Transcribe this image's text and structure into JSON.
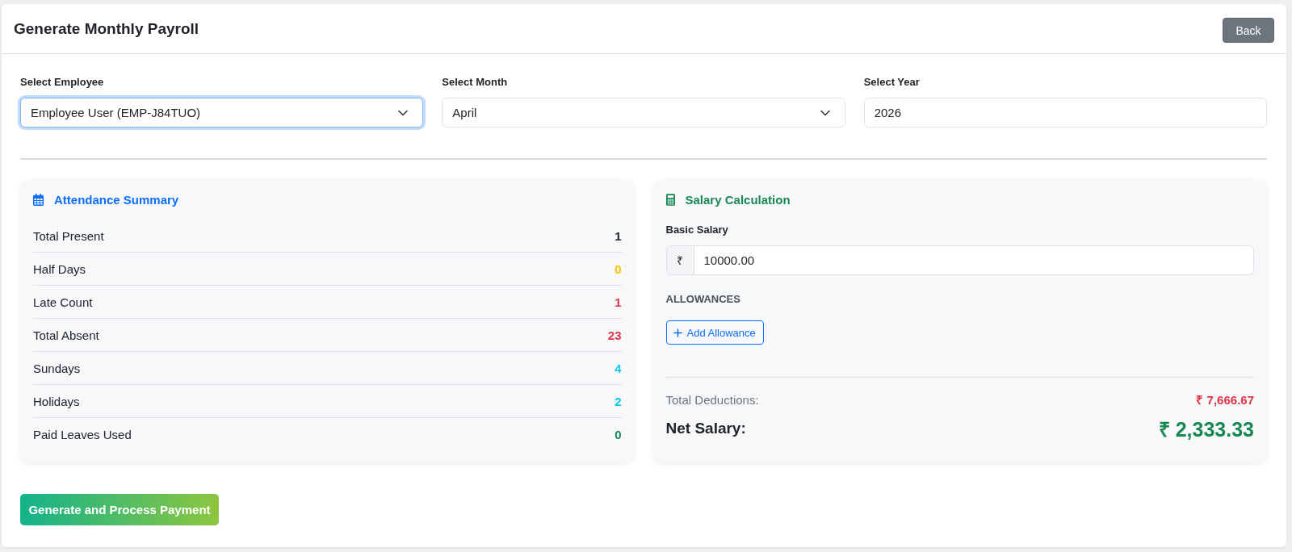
{
  "header": {
    "title": "Generate Monthly Payroll",
    "back_button": "Back"
  },
  "filters": [
    {
      "kind": "select",
      "label": "Select Employee",
      "value": "Employee User (EMP-J84TUO)",
      "focused": true
    },
    {
      "kind": "select",
      "label": "Select Month",
      "value": "April",
      "focused": false
    },
    {
      "kind": "input",
      "label": "Select Year",
      "value": "2026",
      "focused": false
    }
  ],
  "attendance": {
    "title": "Attendance Summary",
    "rows": [
      {
        "label": "Total Present",
        "value": "1",
        "color": "#212529"
      },
      {
        "label": "Half Days",
        "value": "0",
        "color": "#ffc107"
      },
      {
        "label": "Late Count",
        "value": "1",
        "color": "#dc3545"
      },
      {
        "label": "Total Absent",
        "value": "23",
        "color": "#dc3545"
      },
      {
        "label": "Sundays",
        "value": "4",
        "color": "#0dcaf0"
      },
      {
        "label": "Holidays",
        "value": "2",
        "color": "#0dcaf0"
      },
      {
        "label": "Paid Leaves Used",
        "value": "0",
        "color": "#198754"
      }
    ]
  },
  "salary": {
    "title": "Salary Calculation",
    "basic_salary": {
      "label": "Basic Salary",
      "currency": "₹",
      "value": "10000.00"
    },
    "allowances": {
      "heading": "ALLOWANCES",
      "add_button": "Add Allowance"
    },
    "total_deductions": {
      "label": "Total Deductions:",
      "value": "₹ 7,666.67"
    },
    "net_salary": {
      "label": "Net Salary:",
      "value": "₹ 2,333.33"
    }
  },
  "submit_button": "Generate and Process Payment"
}
